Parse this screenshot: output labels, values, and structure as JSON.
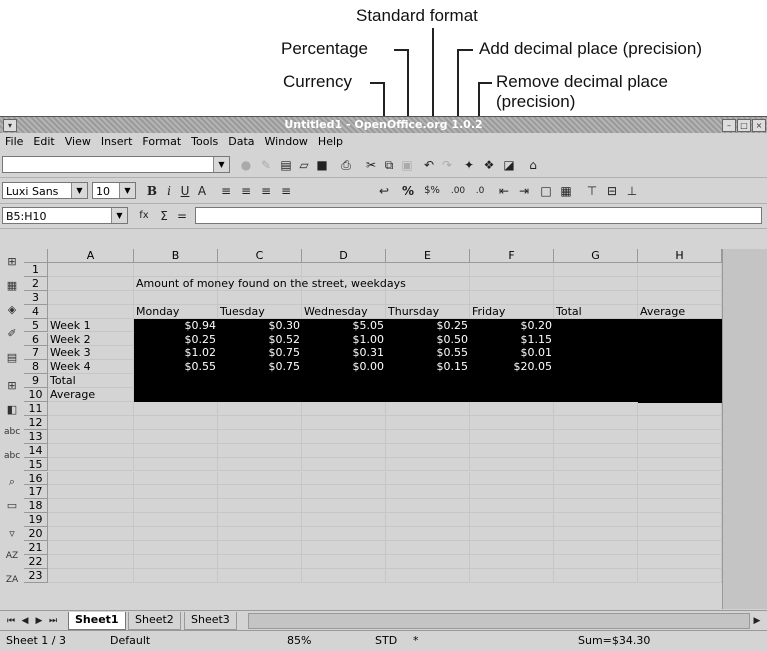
{
  "callouts": {
    "standard_format": "Standard format",
    "percentage": "Percentage",
    "add_decimal": "Add decimal place (precision)",
    "currency": "Currency",
    "remove_decimal_line1": "Remove decimal place",
    "remove_decimal_line2": "(precision)"
  },
  "window": {
    "title": "Untitled1 - OpenOffice.org 1.0.2"
  },
  "menu": [
    "File",
    "Edit",
    "View",
    "Insert",
    "Format",
    "Tools",
    "Data",
    "Window",
    "Help"
  ],
  "format_bar": {
    "font_name": "Luxi Sans",
    "font_size": "10"
  },
  "formula_bar": {
    "cell_ref": "B5:H10",
    "value": ""
  },
  "columns": [
    "A",
    "B",
    "C",
    "D",
    "E",
    "F",
    "G",
    "H"
  ],
  "rows": [
    "1",
    "2",
    "3",
    "4",
    "5",
    "6",
    "7",
    "8",
    "9",
    "10",
    "11",
    "12",
    "13",
    "14",
    "15",
    "16",
    "17",
    "18",
    "19",
    "20",
    "21",
    "22",
    "23"
  ],
  "sheet": {
    "heading": "Amount of money found on the street, weekdays",
    "header_row": [
      "Monday",
      "Tuesday",
      "Wednesday",
      "Thursday",
      "Friday",
      "Total",
      "Average"
    ],
    "row_labels": [
      "Week 1",
      "Week 2",
      "Week 3",
      "Week 4",
      "Total",
      "Average"
    ],
    "data": [
      [
        "$0.94",
        "$0.30",
        "$5.05",
        "$0.25",
        "$0.20"
      ],
      [
        "$0.25",
        "$0.52",
        "$1.00",
        "$0.50",
        "$1.15"
      ],
      [
        "$1.02",
        "$0.75",
        "$0.31",
        "$0.55",
        "$0.01"
      ],
      [
        "$0.55",
        "$0.75",
        "$0.00",
        "$0.15",
        "$20.05"
      ]
    ]
  },
  "tabs": [
    "Sheet1",
    "Sheet2",
    "Sheet3"
  ],
  "status": {
    "sheet": "Sheet 1 / 3",
    "style": "Default",
    "zoom": "85%",
    "mode": "STD",
    "modified": "*",
    "sum": "Sum=$34.30"
  }
}
